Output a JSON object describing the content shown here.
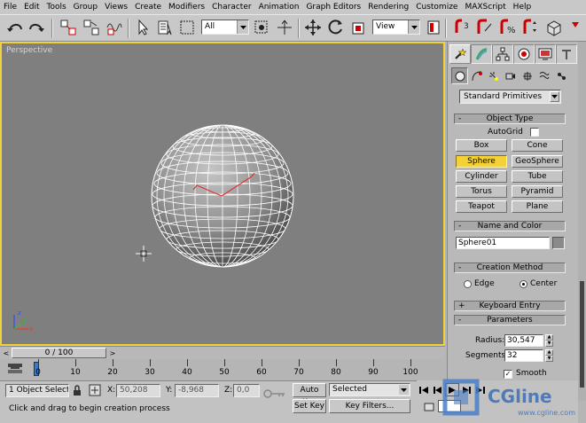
{
  "menu": [
    "File",
    "Edit",
    "Tools",
    "Group",
    "Views",
    "Create",
    "Modifiers",
    "Character",
    "Animation",
    "Graph Editors",
    "Rendering",
    "Customize",
    "MAXScript",
    "Help"
  ],
  "toolbar": {
    "selection_filter": "All",
    "reference_coord": "View"
  },
  "viewport": {
    "label": "Perspective",
    "axis_x": "x",
    "axis_y": "y",
    "axis_z": "z",
    "colors": {
      "background": "#7f7f7f",
      "border_active": "#f2d13e",
      "wire": "#ffffff",
      "grid": "#e03030"
    }
  },
  "command_panel": {
    "category_dropdown": "Standard Primitives",
    "object_type": {
      "title": "Object Type",
      "autogrid_label": "AutoGrid",
      "buttons": [
        "Box",
        "Cone",
        "Sphere",
        "GeoSphere",
        "Cylinder",
        "Tube",
        "Torus",
        "Pyramid",
        "Teapot",
        "Plane"
      ],
      "active": "Sphere"
    },
    "name_and_color": {
      "title": "Name and Color",
      "name_value": "Sphere01"
    },
    "creation_method": {
      "title": "Creation Method",
      "options": [
        "Edge",
        "Center"
      ],
      "selected": "Center"
    },
    "keyboard_entry": {
      "title": "Keyboard Entry",
      "sign": "+"
    },
    "parameters": {
      "title": "Parameters",
      "radius_label": "Radius:",
      "radius_value": "30,547",
      "segments_label": "Segments:",
      "segments_value": "32",
      "smooth_label": "Smooth"
    },
    "collapse_sign": "-"
  },
  "time_slider": {
    "label": "0 / 100",
    "left_arrow": "<",
    "right_arrow": ">"
  },
  "trackbar": {
    "ticks": [
      "0",
      "10",
      "20",
      "30",
      "40",
      "50",
      "60",
      "70",
      "80",
      "90",
      "100"
    ]
  },
  "status": {
    "selection": "1 Object Selecte",
    "x_label": "X:",
    "x_value": "50,208",
    "y_label": "Y:",
    "y_value": "-8,968",
    "z_label": "Z:",
    "z_value": "0,0",
    "prompt": "Click and drag to begin creation process",
    "auto_key": "Auto Key",
    "set_key": "Set Key",
    "key_mode": "Selected",
    "key_filters": "Key Filters..."
  },
  "watermark": {
    "brand": "CGline",
    "url": "www.cgline.com"
  }
}
